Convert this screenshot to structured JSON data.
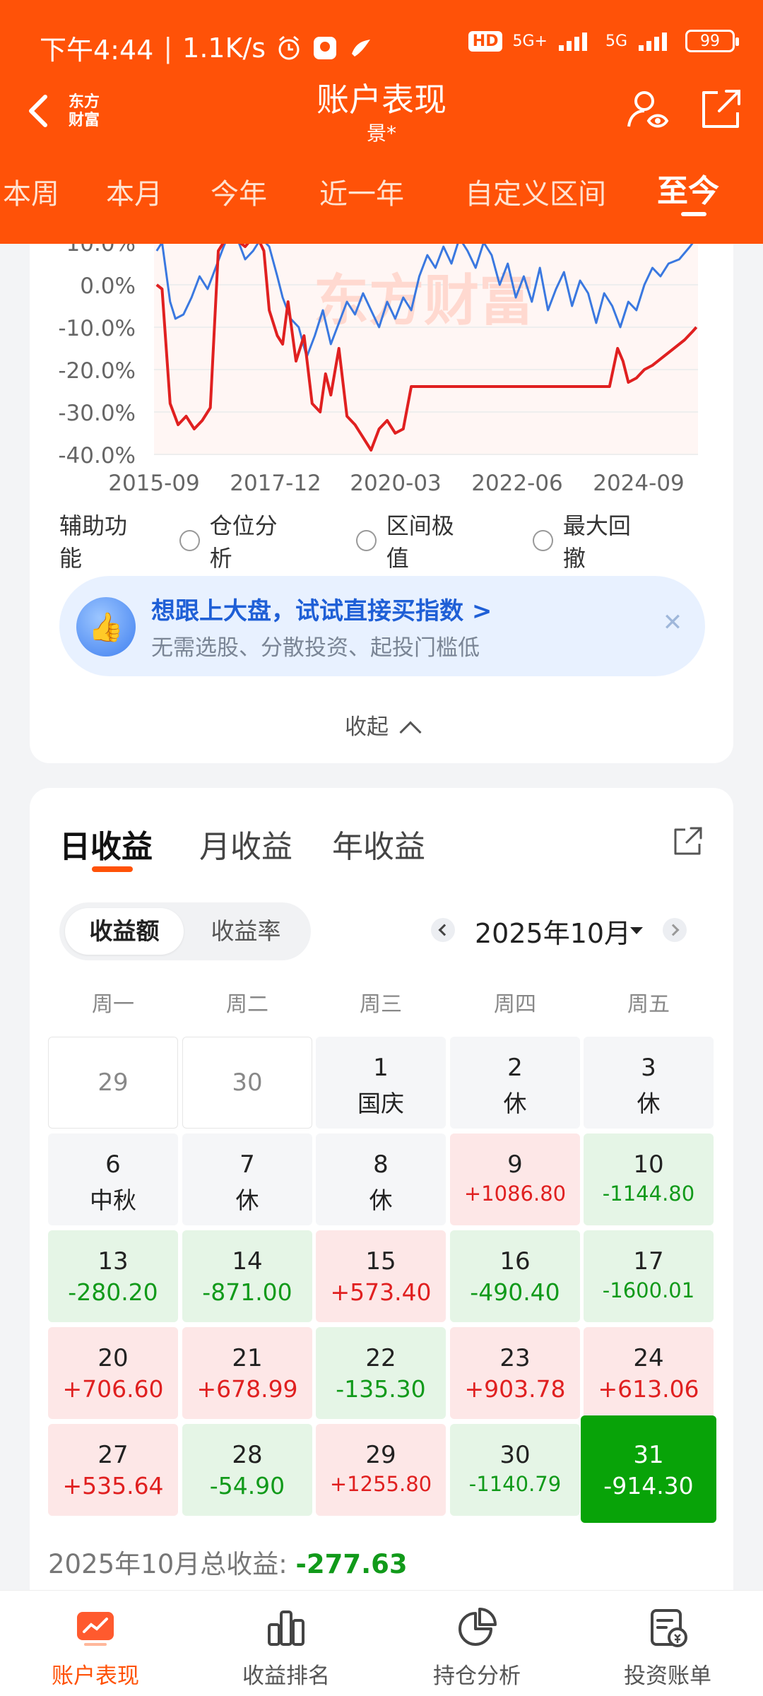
{
  "status_bar": {
    "time": "下午4:44",
    "speed": "1.1K/s",
    "network1": "5G+",
    "network2": "5G",
    "hd": "HD",
    "battery": "99"
  },
  "header": {
    "logo_line1": "东方",
    "logo_line2": "财富",
    "title": "账户表现",
    "subtitle": "景*"
  },
  "period_tabs": [
    "本周",
    "本月",
    "今年",
    "近一年",
    "自定义区间",
    "至今"
  ],
  "period_active": "至今",
  "chart_data": {
    "type": "line",
    "ylim": [
      -40,
      10
    ],
    "y_ticks": [
      "10.0%",
      "0.0%",
      "-10.0%",
      "-20.0%",
      "-30.0%",
      "-40.0%"
    ],
    "x_ticks": [
      "2015-09",
      "2017-12",
      "2020-03",
      "2022-06",
      "2024-09"
    ],
    "watermark": "东方财富",
    "series": [
      {
        "color": "#3a78e0",
        "x": [
          2015.75,
          2015.85,
          2016.0,
          2016.1,
          2016.25,
          2016.4,
          2016.55,
          2016.7,
          2016.85,
          2017.0,
          2017.1,
          2017.25,
          2017.4,
          2017.55,
          2017.7,
          2017.85,
          2018.0,
          2018.1,
          2018.25,
          2018.4,
          2018.55,
          2018.7,
          2018.85,
          2019.0,
          2019.15,
          2019.3,
          2019.45,
          2019.6,
          2019.75,
          2019.9,
          2020.05,
          2020.2,
          2020.35,
          2020.5,
          2020.65,
          2020.8,
          2020.95,
          2021.1,
          2021.25,
          2021.4,
          2021.55,
          2021.7,
          2021.85,
          2022.0,
          2022.15,
          2022.3,
          2022.45,
          2022.6,
          2022.75,
          2022.9,
          2023.05,
          2023.2,
          2023.35,
          2023.5,
          2023.65,
          2023.8,
          2023.95,
          2024.1,
          2024.25,
          2024.4,
          2024.55,
          2024.7,
          2024.85,
          2025.0,
          2025.15,
          2025.3,
          2025.5,
          2025.7,
          2025.82
        ],
        "y": [
          8,
          10,
          -4,
          -8,
          -7,
          -3,
          2,
          -1,
          4,
          9,
          12,
          11,
          6,
          8,
          11,
          9,
          2,
          -3,
          -8,
          -10,
          -17,
          -12,
          -6,
          -14,
          -9,
          -4,
          -7,
          -2,
          -6,
          -10,
          -4,
          -8,
          -3,
          -6,
          2,
          7,
          4,
          9,
          5,
          11,
          8,
          4,
          10,
          7,
          0,
          5,
          -3,
          2,
          -4,
          4,
          -6,
          -1,
          3,
          -5,
          1,
          -2,
          -9,
          -2,
          -5,
          -10,
          -4,
          -6,
          0,
          4,
          2,
          5,
          6,
          9,
          11
        ]
      },
      {
        "color": "#e02020",
        "x": [
          2015.75,
          2015.85,
          2016.0,
          2016.15,
          2016.3,
          2016.45,
          2016.6,
          2016.75,
          2016.9,
          2017.0,
          2017.05,
          2017.2,
          2017.4,
          2017.6,
          2017.75,
          2017.85,
          2018.0,
          2018.1,
          2018.2,
          2018.35,
          2018.5,
          2018.65,
          2018.8,
          2018.9,
          2019.0,
          2019.15,
          2019.3,
          2019.45,
          2019.6,
          2019.75,
          2019.9,
          2020.05,
          2020.2,
          2020.35,
          2020.5,
          2020.65,
          2020.8,
          2021.0,
          2021.5,
          2022.0,
          2022.5,
          2023.0,
          2023.5,
          2024.0,
          2024.2,
          2024.35,
          2024.45,
          2024.55,
          2024.7,
          2024.85,
          2025.0,
          2025.2,
          2025.4,
          2025.6,
          2025.75,
          2025.82
        ],
        "y": [
          0,
          -1,
          -28,
          -33,
          -31,
          -34,
          -32,
          -29,
          8,
          10,
          12,
          11,
          9,
          12,
          8,
          -6,
          -12,
          -14,
          -4,
          -18,
          -12,
          -28,
          -30,
          -21,
          -26,
          -15,
          -31,
          -33,
          -36,
          -39,
          -34,
          -32,
          -35,
          -34,
          -24,
          -24,
          -24,
          -24,
          -24,
          -24,
          -24,
          -24,
          -24,
          -24,
          -24,
          -15,
          -18,
          -23,
          -22,
          -20,
          -19,
          -17,
          -15,
          -13,
          -11,
          -10
        ]
      }
    ]
  },
  "aux": {
    "label": "辅助功能",
    "options": [
      "仓位分析",
      "区间极值",
      "最大回撤"
    ]
  },
  "promo": {
    "title": "想跟上大盘，试试直接买指数 >",
    "desc": "无需选股、分散投资、起投门槛低"
  },
  "collapse_label": "收起",
  "returns": {
    "tabs": [
      "日收益",
      "月收益",
      "年收益"
    ],
    "active_tab": "日收益",
    "segment": [
      "收益额",
      "收益率"
    ],
    "month": "2025年10月",
    "weekdays": [
      "周一",
      "周二",
      "周三",
      "周四",
      "周五"
    ],
    "cells": [
      {
        "day": "29",
        "label": "",
        "type": "empty"
      },
      {
        "day": "30",
        "label": "",
        "type": "empty"
      },
      {
        "day": "1",
        "label": "国庆",
        "type": "holiday"
      },
      {
        "day": "2",
        "label": "休",
        "type": "holiday"
      },
      {
        "day": "3",
        "label": "休",
        "type": "holiday"
      },
      {
        "day": "6",
        "label": "中秋",
        "type": "holiday"
      },
      {
        "day": "7",
        "label": "休",
        "type": "holiday"
      },
      {
        "day": "8",
        "label": "休",
        "type": "holiday"
      },
      {
        "day": "9",
        "label": "+1086.80",
        "type": "up"
      },
      {
        "day": "10",
        "label": "-1144.80",
        "type": "down"
      },
      {
        "day": "13",
        "label": "-280.20",
        "type": "down"
      },
      {
        "day": "14",
        "label": "-871.00",
        "type": "down"
      },
      {
        "day": "15",
        "label": "+573.40",
        "type": "up"
      },
      {
        "day": "16",
        "label": "-490.40",
        "type": "down"
      },
      {
        "day": "17",
        "label": "-1600.01",
        "type": "down"
      },
      {
        "day": "20",
        "label": "+706.60",
        "type": "up"
      },
      {
        "day": "21",
        "label": "+678.99",
        "type": "up"
      },
      {
        "day": "22",
        "label": "-135.30",
        "type": "down"
      },
      {
        "day": "23",
        "label": "+903.78",
        "type": "up"
      },
      {
        "day": "24",
        "label": "+613.06",
        "type": "up"
      },
      {
        "day": "27",
        "label": "+535.64",
        "type": "up"
      },
      {
        "day": "28",
        "label": "-54.90",
        "type": "down"
      },
      {
        "day": "29",
        "label": "+1255.80",
        "type": "up"
      },
      {
        "day": "30",
        "label": "-1140.79",
        "type": "down"
      },
      {
        "day": "31",
        "label": "-914.30",
        "type": "sel"
      }
    ],
    "total_label": "2025年10月总收益: ",
    "total_value": "-277.63"
  },
  "bottom_nav": [
    "账户表现",
    "收益排名",
    "持仓分析",
    "投资账单"
  ]
}
